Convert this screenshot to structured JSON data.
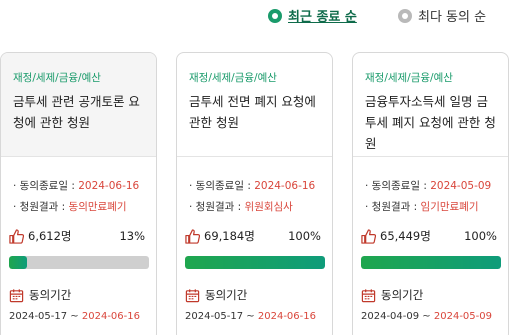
{
  "sort": {
    "options": [
      {
        "label": "최근 종료 순",
        "selected": true
      },
      {
        "label": "최다 동의 순",
        "selected": false
      }
    ]
  },
  "labels": {
    "end_date": "· 동의종료일 : ",
    "result": "· 청원결과 : ",
    "period": "동의기간",
    "tilde": " ~ "
  },
  "colors": {
    "accent": "#1a9b6b",
    "highlight": "#d9463b",
    "bar_track": "#cfcfcf"
  },
  "cards": [
    {
      "category": "재정/세제/금융/예산",
      "title": "금투세 관련 공개토론 요청에 관한 청원",
      "end_date": "2024-06-16",
      "result": "동의만료폐기",
      "count": "6,612명",
      "percent": "13%",
      "progress": 0.13,
      "period_start": "2024-05-17",
      "period_end": "2024-06-16"
    },
    {
      "category": "재정/세제/금융/예산",
      "title": "금투세 전면 폐지 요청에 관한 청원",
      "end_date": "2024-06-16",
      "result": "위원회심사",
      "count": "69,184명",
      "percent": "100%",
      "progress": 1.0,
      "period_start": "2024-05-17",
      "period_end": "2024-06-16"
    },
    {
      "category": "재정/세제/금융/예산",
      "title": "금융투자소득세 일명 금투세 폐지 요청에 관한 청원",
      "end_date": "2024-05-09",
      "result": "임기만료폐기",
      "count": "65,449명",
      "percent": "100%",
      "progress": 1.0,
      "period_start": "2024-04-09",
      "period_end": "2024-05-09"
    }
  ]
}
